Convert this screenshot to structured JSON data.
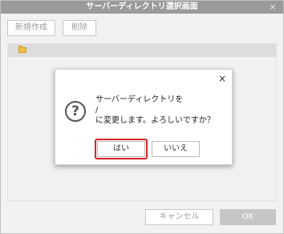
{
  "window": {
    "title": "サーバーディレクトリ選択画面",
    "close_glyph": "×"
  },
  "toolbar": {
    "new_label": "新規作成",
    "delete_label": "削除"
  },
  "footer": {
    "cancel_label": "キャンセル",
    "ok_label": "OK"
  },
  "dialog": {
    "close_glyph": "×",
    "icon": "question-icon",
    "icon_glyph": "?",
    "message_lines": [
      "サーバーディレクトリを",
      "/",
      "に変更します。よろしいですか？"
    ],
    "yes_label": "はい",
    "no_label": "いいえ"
  },
  "colors": {
    "titlebar": "#9a9a9a",
    "highlight": "#d9252b",
    "ok_button": "#c6c6c6"
  }
}
